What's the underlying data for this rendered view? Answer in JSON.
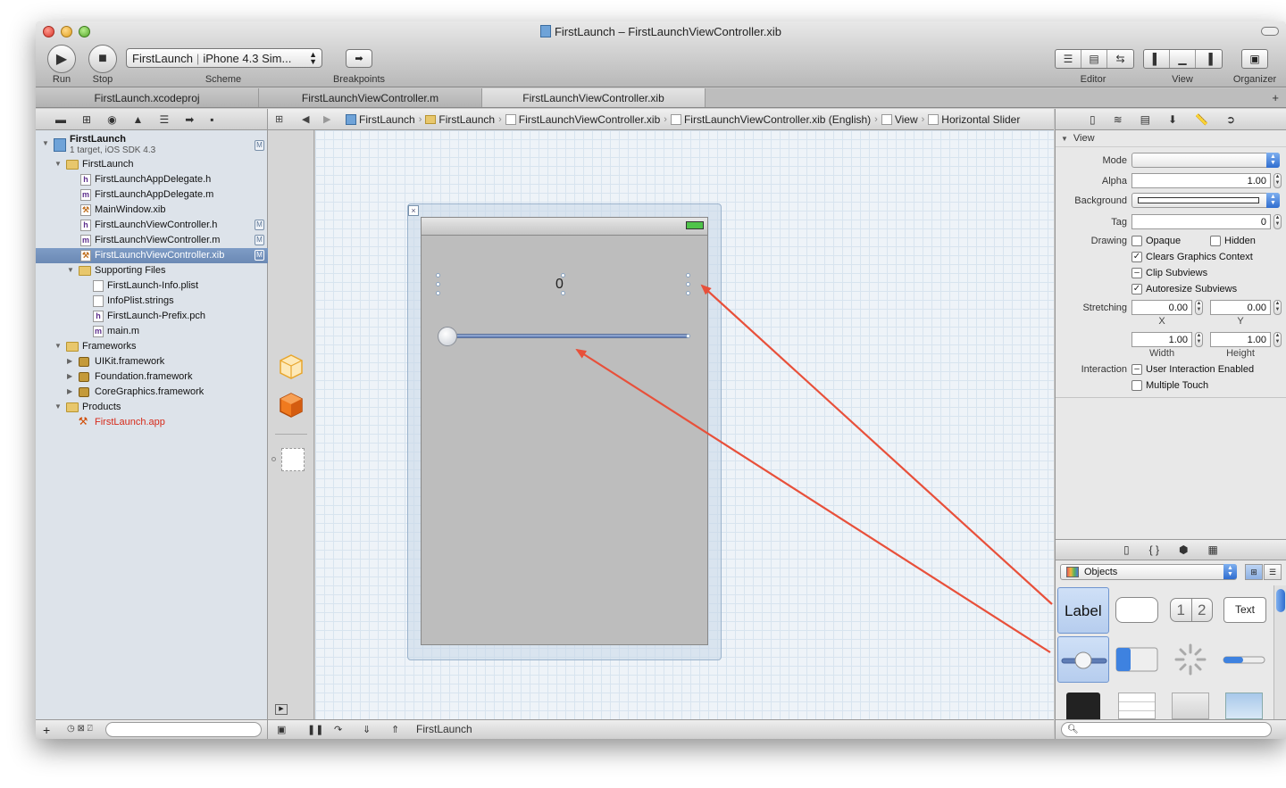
{
  "window": {
    "title": "FirstLaunch – FirstLaunchViewController.xib"
  },
  "toolbar": {
    "run_label": "Run",
    "stop_label": "Stop",
    "scheme_label": "Scheme",
    "scheme_target": "FirstLaunch",
    "scheme_destination": "iPhone 4.3 Sim...",
    "breakpoints_label": "Breakpoints",
    "editor_label": "Editor",
    "view_label": "View",
    "organizer_label": "Organizer"
  },
  "tabs": [
    {
      "label": "FirstLaunch.xcodeproj"
    },
    {
      "label": "FirstLaunchViewController.m"
    },
    {
      "label": "FirstLaunchViewController.xib"
    }
  ],
  "jumpbar": {
    "crumbs": [
      "FirstLaunch",
      "FirstLaunch",
      "FirstLaunchViewController.xib",
      "FirstLaunchViewController.xib (English)",
      "View",
      "Horizontal Slider"
    ]
  },
  "navigator": {
    "project_name": "FirstLaunch",
    "project_sub": "1 target, iOS SDK 4.3",
    "items": [
      {
        "label": "FirstLaunch",
        "badge": "M"
      },
      {
        "label": "FirstLaunch"
      },
      {
        "label": "FirstLaunchAppDelegate.h"
      },
      {
        "label": "FirstLaunchAppDelegate.m"
      },
      {
        "label": "MainWindow.xib"
      },
      {
        "label": "FirstLaunchViewController.h",
        "badge": "M"
      },
      {
        "label": "FirstLaunchViewController.m",
        "badge": "M"
      },
      {
        "label": "FirstLaunchViewController.xib",
        "badge": "M"
      },
      {
        "label": "Supporting Files"
      },
      {
        "label": "FirstLaunch-Info.plist"
      },
      {
        "label": "InfoPlist.strings"
      },
      {
        "label": "FirstLaunch-Prefix.pch"
      },
      {
        "label": "main.m"
      },
      {
        "label": "Frameworks"
      },
      {
        "label": "UIKit.framework"
      },
      {
        "label": "Foundation.framework"
      },
      {
        "label": "CoreGraphics.framework"
      },
      {
        "label": "Products"
      },
      {
        "label": "FirstLaunch.app"
      }
    ]
  },
  "canvas": {
    "label_text": "0"
  },
  "debugbar": {
    "target": "FirstLaunch"
  },
  "inspector": {
    "section": "View",
    "mode_label": "Mode",
    "mode_value": "",
    "alpha_label": "Alpha",
    "alpha_value": "1.00",
    "background_label": "Background",
    "tag_label": "Tag",
    "tag_value": "0",
    "drawing_label": "Drawing",
    "opaque": "Opaque",
    "hidden": "Hidden",
    "clears_graphics": "Clears Graphics Context",
    "clip_subviews": "Clip Subviews",
    "autoresize_subviews": "Autoresize Subviews",
    "stretching_label": "Stretching",
    "stretch_x": "0.00",
    "stretch_y": "0.00",
    "x_label": "X",
    "y_label": "Y",
    "stretch_w": "1.00",
    "stretch_h": "1.00",
    "width_label": "Width",
    "height_label": "Height",
    "interaction_label": "Interaction",
    "user_interaction": "User Interaction Enabled",
    "multiple_touch": "Multiple Touch"
  },
  "library": {
    "selector": "Objects",
    "label_item": "Label",
    "segmented_1": "1",
    "segmented_2": "2",
    "textfield_item": "Text"
  },
  "colors": {
    "selection": "#6b89b4",
    "arrow": "#e8503a",
    "canvas_grid": "#d8e4ef"
  }
}
